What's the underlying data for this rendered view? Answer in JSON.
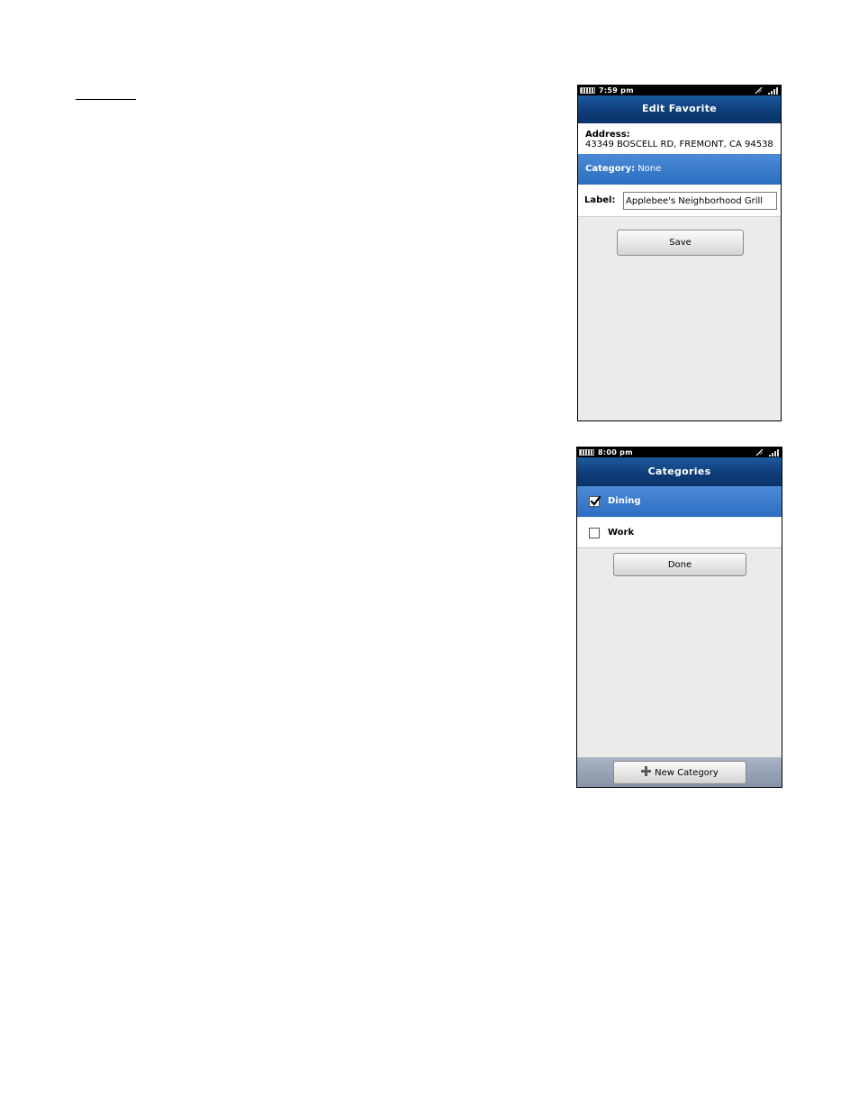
{
  "edit_favorite_screen": {
    "status": {
      "time": "7:59 pm",
      "icons": [
        "battery-icon",
        "wifi-icon",
        "signal-icon"
      ]
    },
    "title": "Edit Favorite",
    "address": {
      "label": "Address:",
      "value": "43349 BOSCELL RD, FREMONT, CA 94538"
    },
    "category": {
      "label": "Category:",
      "value": "None"
    },
    "label_field": {
      "label": "Label:",
      "value": "Applebee's Neighborhood Grill"
    },
    "save_label": "Save"
  },
  "categories_screen": {
    "status": {
      "time": "8:00 pm",
      "icons": [
        "battery-icon",
        "wifi-icon",
        "signal-icon"
      ]
    },
    "title": "Categories",
    "items": [
      {
        "label": "Dining",
        "checked": true
      },
      {
        "label": "Work",
        "checked": false
      }
    ],
    "done_label": "Done",
    "new_category_label": "New Category"
  },
  "colors": {
    "title_bar": "#0f3e79",
    "selected_row": "#3a7dcf",
    "screen_background": "#ebebeb",
    "bottom_bar": "#98a4b6"
  }
}
